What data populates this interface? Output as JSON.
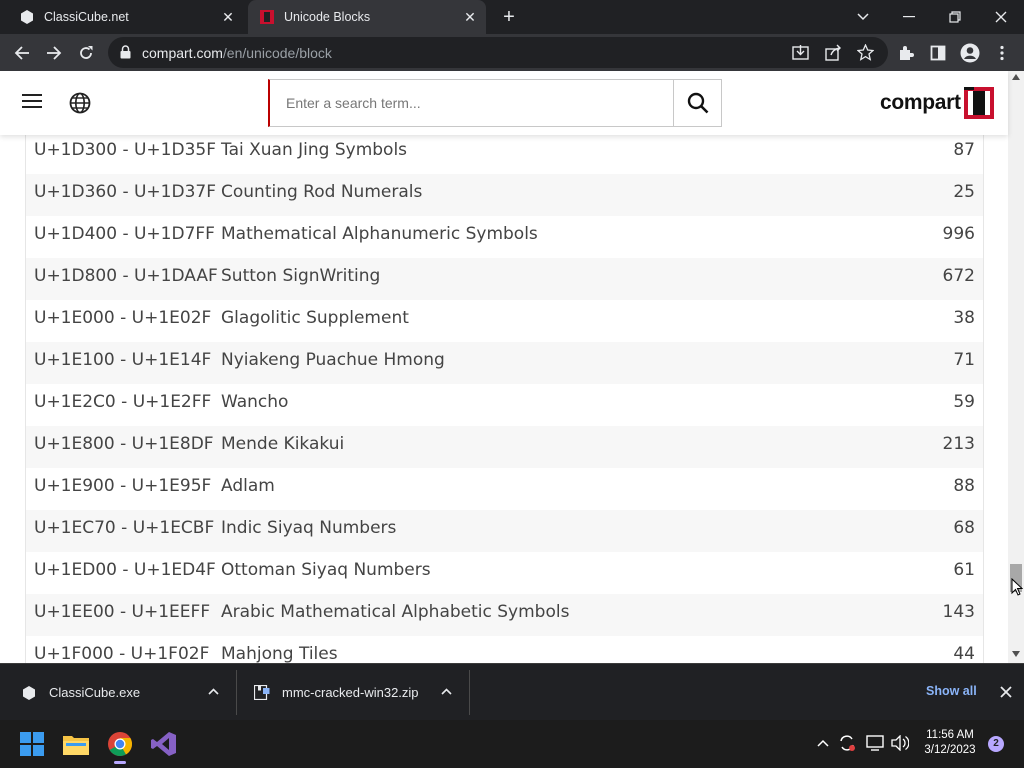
{
  "browser": {
    "tabs": [
      {
        "title": "ClassiCube.net",
        "active": false
      },
      {
        "title": "Unicode Blocks",
        "active": true
      }
    ],
    "address": {
      "host": "compart.com",
      "path": "/en/unicode/block"
    }
  },
  "site": {
    "search_placeholder": "Enter a search term...",
    "logo_text": "compart"
  },
  "blocks": [
    {
      "range": "U+1D300 - U+1D35F",
      "name": "Tai Xuan Jing Symbols",
      "count": "87"
    },
    {
      "range": "U+1D360 - U+1D37F",
      "name": "Counting Rod Numerals",
      "count": "25"
    },
    {
      "range": "U+1D400 - U+1D7FF",
      "name": "Mathematical Alphanumeric Symbols",
      "count": "996"
    },
    {
      "range": "U+1D800 - U+1DAAF",
      "name": "Sutton SignWriting",
      "count": "672"
    },
    {
      "range": "U+1E000 - U+1E02F",
      "name": "Glagolitic Supplement",
      "count": "38"
    },
    {
      "range": "U+1E100 - U+1E14F",
      "name": "Nyiakeng Puachue Hmong",
      "count": "71"
    },
    {
      "range": "U+1E2C0 - U+1E2FF",
      "name": "Wancho",
      "count": "59"
    },
    {
      "range": "U+1E800 - U+1E8DF",
      "name": "Mende Kikakui",
      "count": "213"
    },
    {
      "range": "U+1E900 - U+1E95F",
      "name": "Adlam",
      "count": "88"
    },
    {
      "range": "U+1EC70 - U+1ECBF",
      "name": "Indic Siyaq Numbers",
      "count": "68"
    },
    {
      "range": "U+1ED00 - U+1ED4F",
      "name": "Ottoman Siyaq Numbers",
      "count": "61"
    },
    {
      "range": "U+1EE00 - U+1EEFF",
      "name": "Arabic Mathematical Alphabetic Symbols",
      "count": "143"
    },
    {
      "range": "U+1F000 - U+1F02F",
      "name": "Mahjong Tiles",
      "count": "44"
    }
  ],
  "downloads": {
    "items": [
      {
        "filename": "ClassiCube.exe"
      },
      {
        "filename": "mmc-cracked-win32.zip"
      }
    ],
    "show_all": "Show all"
  },
  "taskbar": {
    "time": "11:56 AM",
    "date": "3/12/2023",
    "notifications": "2"
  },
  "colors": {
    "brand_red": "#c8102e",
    "chrome_dark": "#202124",
    "chrome_toolbar": "#35363a",
    "link_blue": "#8ab4f8"
  }
}
